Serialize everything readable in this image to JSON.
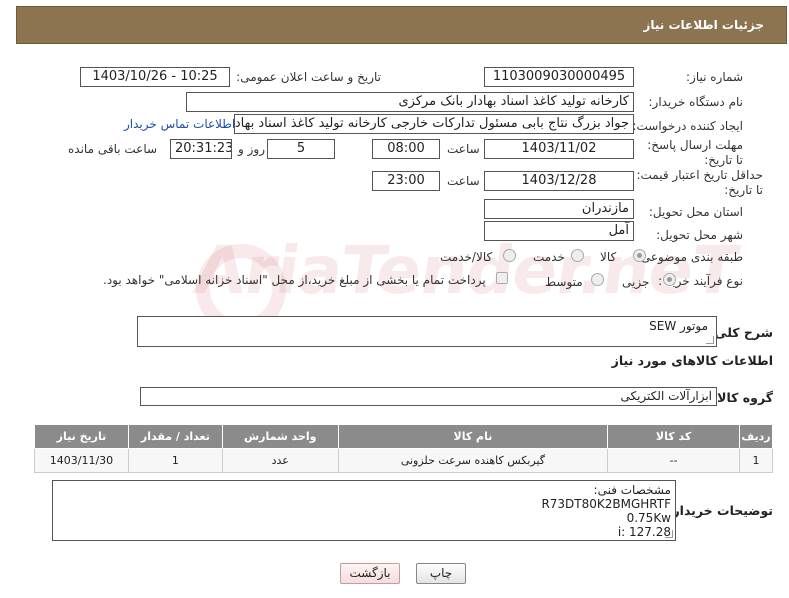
{
  "header": {
    "title": "جزئیات اطلاعات نیاز"
  },
  "fields": {
    "need_number_label": "شماره نیاز:",
    "need_number": "1103009030000495",
    "announce_label": "تاریخ و ساعت اعلان عمومی:",
    "announce_value": "1403/10/26 - 10:25",
    "buyer_org_label": "نام دستگاه خریدار:",
    "buyer_org": "کارخانه تولید کاغذ اسناد بهادار بانک مرکزی",
    "creator_label": "ایجاد کننده درخواست:",
    "creator": "جواد بزرگ نتاج بابی مسئول تدارکات خارجی کارخانه تولید کاغذ اسناد بهادار بانک",
    "contact_link": "اطلاعات تماس خریدار",
    "deadline_label": "مهلت ارسال پاسخ: تا تاریخ:",
    "deadline_date": "1403/11/02",
    "time_label": "ساعت",
    "deadline_time": "08:00",
    "days_value": "5",
    "days_label": "روز و",
    "remaining_time": "20:31:23",
    "remaining_label": "ساعت باقی مانده",
    "validity_label": "حداقل تاریخ اعتبار قیمت: تا تاریخ:",
    "validity_date": "1403/12/28",
    "validity_time": "23:00",
    "province_label": "استان محل تحویل:",
    "province": "مازندران",
    "city_label": "شهر محل تحویل:",
    "city": "آمل",
    "category_label": "طبقه بندی موضوعی:",
    "category_options": [
      "کالا",
      "خدمت",
      "کالا/خدمت"
    ],
    "purchase_label": "نوع فرآیند خرید :",
    "purchase_options": [
      "جزیی",
      "متوسط"
    ],
    "payment_note": "پرداخت تمام یا بخشی از مبلغ خرید،از محل \"اسناد خزانه اسلامی\" خواهد بود."
  },
  "summary": {
    "label": "شرح کلی نیاز:",
    "value": "موتور SEW"
  },
  "goods_section": {
    "title": "اطلاعات کالاهای مورد نیاز",
    "group_label": "گروه کالا:",
    "group_value": "ابزارآلات الکتریکی"
  },
  "table": {
    "headers": [
      "ردیف",
      "کد کالا",
      "نام کالا",
      "واحد شمارش",
      "تعداد / مقدار",
      "تاریخ نیاز"
    ],
    "rows": [
      [
        "1",
        "--",
        "گیربکس کاهنده سرعت حلزونی",
        "عدد",
        "1",
        "1403/11/30"
      ]
    ]
  },
  "buyer_notes": {
    "label": "توضیحات خریدار:",
    "lines": [
      "مشخصات فنی:",
      "R73DT80K2BMGHRTF",
      "0.75Kw",
      "i: 127.28"
    ]
  },
  "buttons": {
    "print": "چاپ",
    "back": "بازگشت"
  },
  "watermark": "AriaTender.neT"
}
